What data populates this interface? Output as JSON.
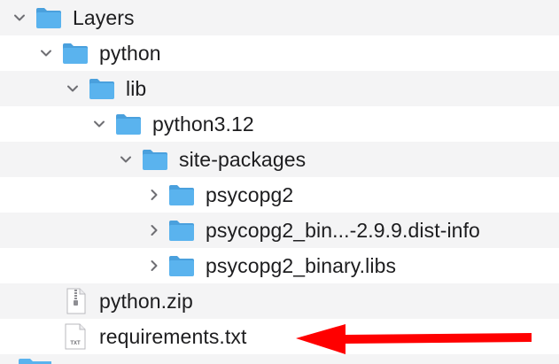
{
  "window": {
    "title": "Layers"
  },
  "tree": {
    "layers": "Layers",
    "python": "python",
    "lib": "lib",
    "python312": "python3.12",
    "site_packages": "site-packages",
    "psycopg2": "psycopg2",
    "dist_info": "psycopg2_bin...-2.9.9.dist-info",
    "binary_libs": "psycopg2_binary.libs",
    "python_zip": "python.zip",
    "requirements": "requirements.txt",
    "txt_badge": "TXT"
  },
  "icons": {
    "folder": "folder-icon",
    "zip": "zip-file-icon",
    "txt": "text-file-icon",
    "expanded": "chevron-down-icon",
    "collapsed": "chevron-right-icon"
  },
  "colors": {
    "folder": "#5ab3ee",
    "folder_tab": "#4aa0dd",
    "arrow": "#ff0000",
    "row_shade": "#f4f4f5"
  }
}
